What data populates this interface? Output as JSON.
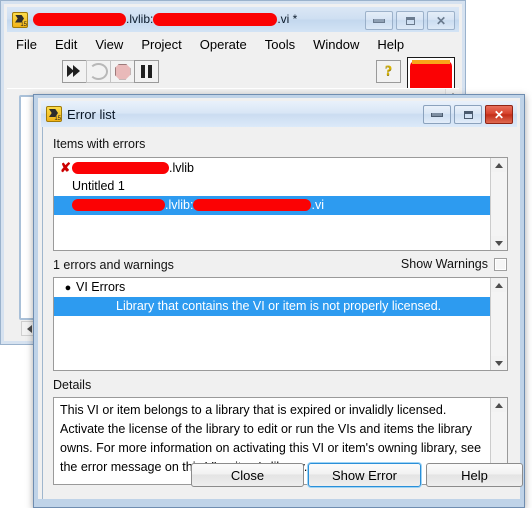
{
  "main_window": {
    "icon": "labview-icon",
    "title_suffix_1": ".lvlib:",
    "title_suffix_2": ".vi *",
    "title_redacted_1": "[redacted]",
    "title_redacted_2": "[redacted]",
    "titlebar_buttons": [
      {
        "name": "minimize-button",
        "glyph": "minimize"
      },
      {
        "name": "maximize-button",
        "glyph": "maximize"
      },
      {
        "name": "close-button",
        "glyph": "close"
      }
    ],
    "menu": [
      "File",
      "Edit",
      "View",
      "Project",
      "Operate",
      "Tools",
      "Window",
      "Help"
    ],
    "toolbar": {
      "run": "run-arrow-icon",
      "run_continuously": "run-continuously-icon",
      "abort": "abort-execution-icon",
      "pause": "pause-icon",
      "help": "?",
      "redacted_region": "[redacted]"
    }
  },
  "dialog": {
    "title": "Error list",
    "icon": "labview-icon",
    "titlebar_buttons": [
      {
        "name": "minimize-button",
        "glyph": "minimize"
      },
      {
        "name": "maximize-button",
        "glyph": "maximize"
      },
      {
        "name": "close-button",
        "glyph": "close"
      }
    ],
    "items_section": {
      "label": "Items with errors",
      "rows": [
        {
          "marker": "✘",
          "redacted": "[redacted]",
          "text": ".lvlib",
          "selected": false
        },
        {
          "marker": "",
          "redacted": "",
          "text": "Untitled 1",
          "selected": false
        },
        {
          "marker": "",
          "redacted": "[redacted]",
          "text": ".lvlib:",
          "redacted2": "[redacted]",
          "text2": ".vi",
          "selected": true
        }
      ]
    },
    "errors_section": {
      "count_label": "1 errors and warnings",
      "show_warnings_label": "Show Warnings",
      "show_warnings_checked": false,
      "rows": [
        {
          "bullet": "●",
          "text": "VI Errors",
          "selected": false,
          "indent": 0
        },
        {
          "bullet": "",
          "text": "Library that contains the VI or item is not properly licensed.",
          "selected": true,
          "indent": 1
        }
      ]
    },
    "details_section": {
      "label": "Details",
      "text": "This VI or item belongs to a library that is expired or invalidly licensed. Activate the license of the library to edit or run the VIs and items the library owns. For more information on activating this VI or item's owning library, see the error message on this VI or item's library."
    },
    "buttons": [
      {
        "name": "close-button",
        "label": "Close",
        "focused": false
      },
      {
        "name": "show-error-button",
        "label": "Show Error",
        "focused": true
      },
      {
        "name": "help-button",
        "label": "Help",
        "focused": false
      }
    ]
  },
  "colors": {
    "selection_blue": "#2d9bf0",
    "redaction_red": "#fb0204",
    "error_x_red": "#cc0000",
    "focus_blue": "#2a8fd8",
    "titlebar_blue": "#cedff2"
  }
}
